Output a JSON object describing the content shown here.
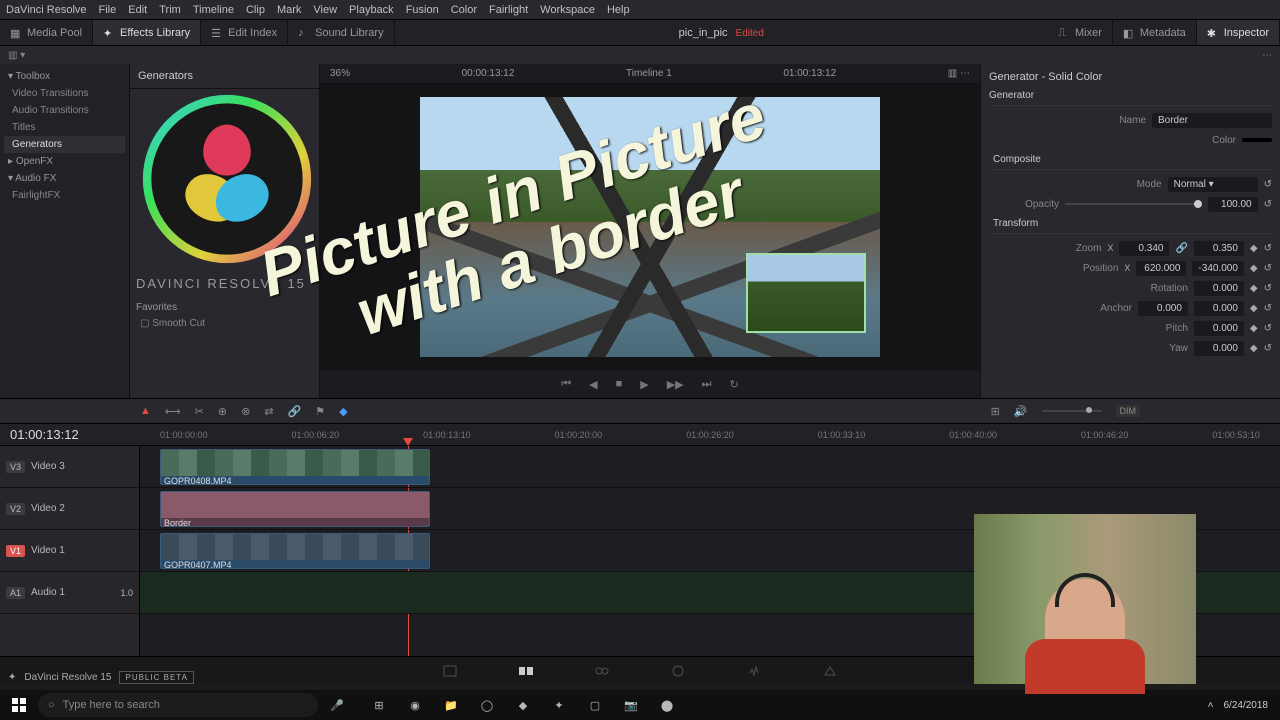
{
  "menubar": [
    "DaVinci Resolve",
    "File",
    "Edit",
    "Trim",
    "Timeline",
    "Clip",
    "Mark",
    "View",
    "Playback",
    "Fusion",
    "Color",
    "Fairlight",
    "Workspace",
    "Help"
  ],
  "workspace": {
    "media_pool": "Media Pool",
    "effects": "Effects Library",
    "edit_index": "Edit Index",
    "sound": "Sound Library",
    "mixer": "Mixer",
    "metadata": "Metadata",
    "inspector": "Inspector"
  },
  "project": {
    "name": "pic_in_pic",
    "modified": "Edited"
  },
  "toolbox": {
    "header": "Toolbox",
    "items": [
      "Video Transitions",
      "Audio Transitions",
      "Titles",
      "Generators"
    ],
    "openfx": "OpenFX",
    "audiofx": "Audio FX",
    "fairlight": "FairlightFX"
  },
  "generators_title": "Generators",
  "brand": "DAVINCI RESOLVE 15",
  "favorites": {
    "title": "Favorites",
    "item": "Smooth Cut"
  },
  "viewer": {
    "zoom": "36%",
    "tc1": "00:00:13:12",
    "tab": "Timeline 1",
    "tc2": "01:00:13:12"
  },
  "inspector": {
    "title": "Generator - Solid Color",
    "section": "Generator",
    "name_lbl": "Name",
    "name_val": "Border",
    "color_lbl": "Color",
    "composite": "Composite",
    "mode_lbl": "Mode",
    "mode_val": "Normal",
    "opacity_lbl": "Opacity",
    "opacity_val": "100.00",
    "transform": "Transform",
    "zoom_lbl": "Zoom",
    "zoom_x": "0.340",
    "zoom_y": "0.350",
    "pos_lbl": "Position",
    "pos_x": "620.000",
    "pos_y": "-340.000",
    "rot_lbl": "Rotation",
    "rot_val": "0.000",
    "anchor_lbl": "Anchor",
    "anchor_x": "0.000",
    "anchor_y": "0.000",
    "pitch_lbl": "Pitch",
    "pitch_val": "0.000",
    "yaw_lbl": "Yaw",
    "yaw_val": "0.000"
  },
  "timeline": {
    "tc": "01:00:13:12",
    "ticks": [
      "01:00:00:00",
      "01:00:06:20",
      "01:00:13:10",
      "01:00:20:00",
      "01:00:26:20",
      "01:00:33:10",
      "01:00:40:00",
      "01:00:46:20",
      "01:00:53:10"
    ]
  },
  "tracks": {
    "v3": {
      "id": "V3",
      "name": "Video 3",
      "clip": "GOPR0408.MP4"
    },
    "v2": {
      "id": "V2",
      "name": "Video 2",
      "clip": "Border"
    },
    "v1": {
      "id": "V1",
      "name": "Video 1",
      "clip": "GOPR0407.MP4"
    },
    "a1": {
      "id": "A1",
      "name": "Audio 1",
      "val": "1.0"
    }
  },
  "status": {
    "app": "DaVinci Resolve 15",
    "beta": "PUBLIC BETA"
  },
  "taskbar": {
    "search": "Type here to search",
    "date": "6/24/2018"
  },
  "overlay": {
    "l1": "Picture in Picture",
    "l2": "with a border"
  },
  "volume": "DIM"
}
